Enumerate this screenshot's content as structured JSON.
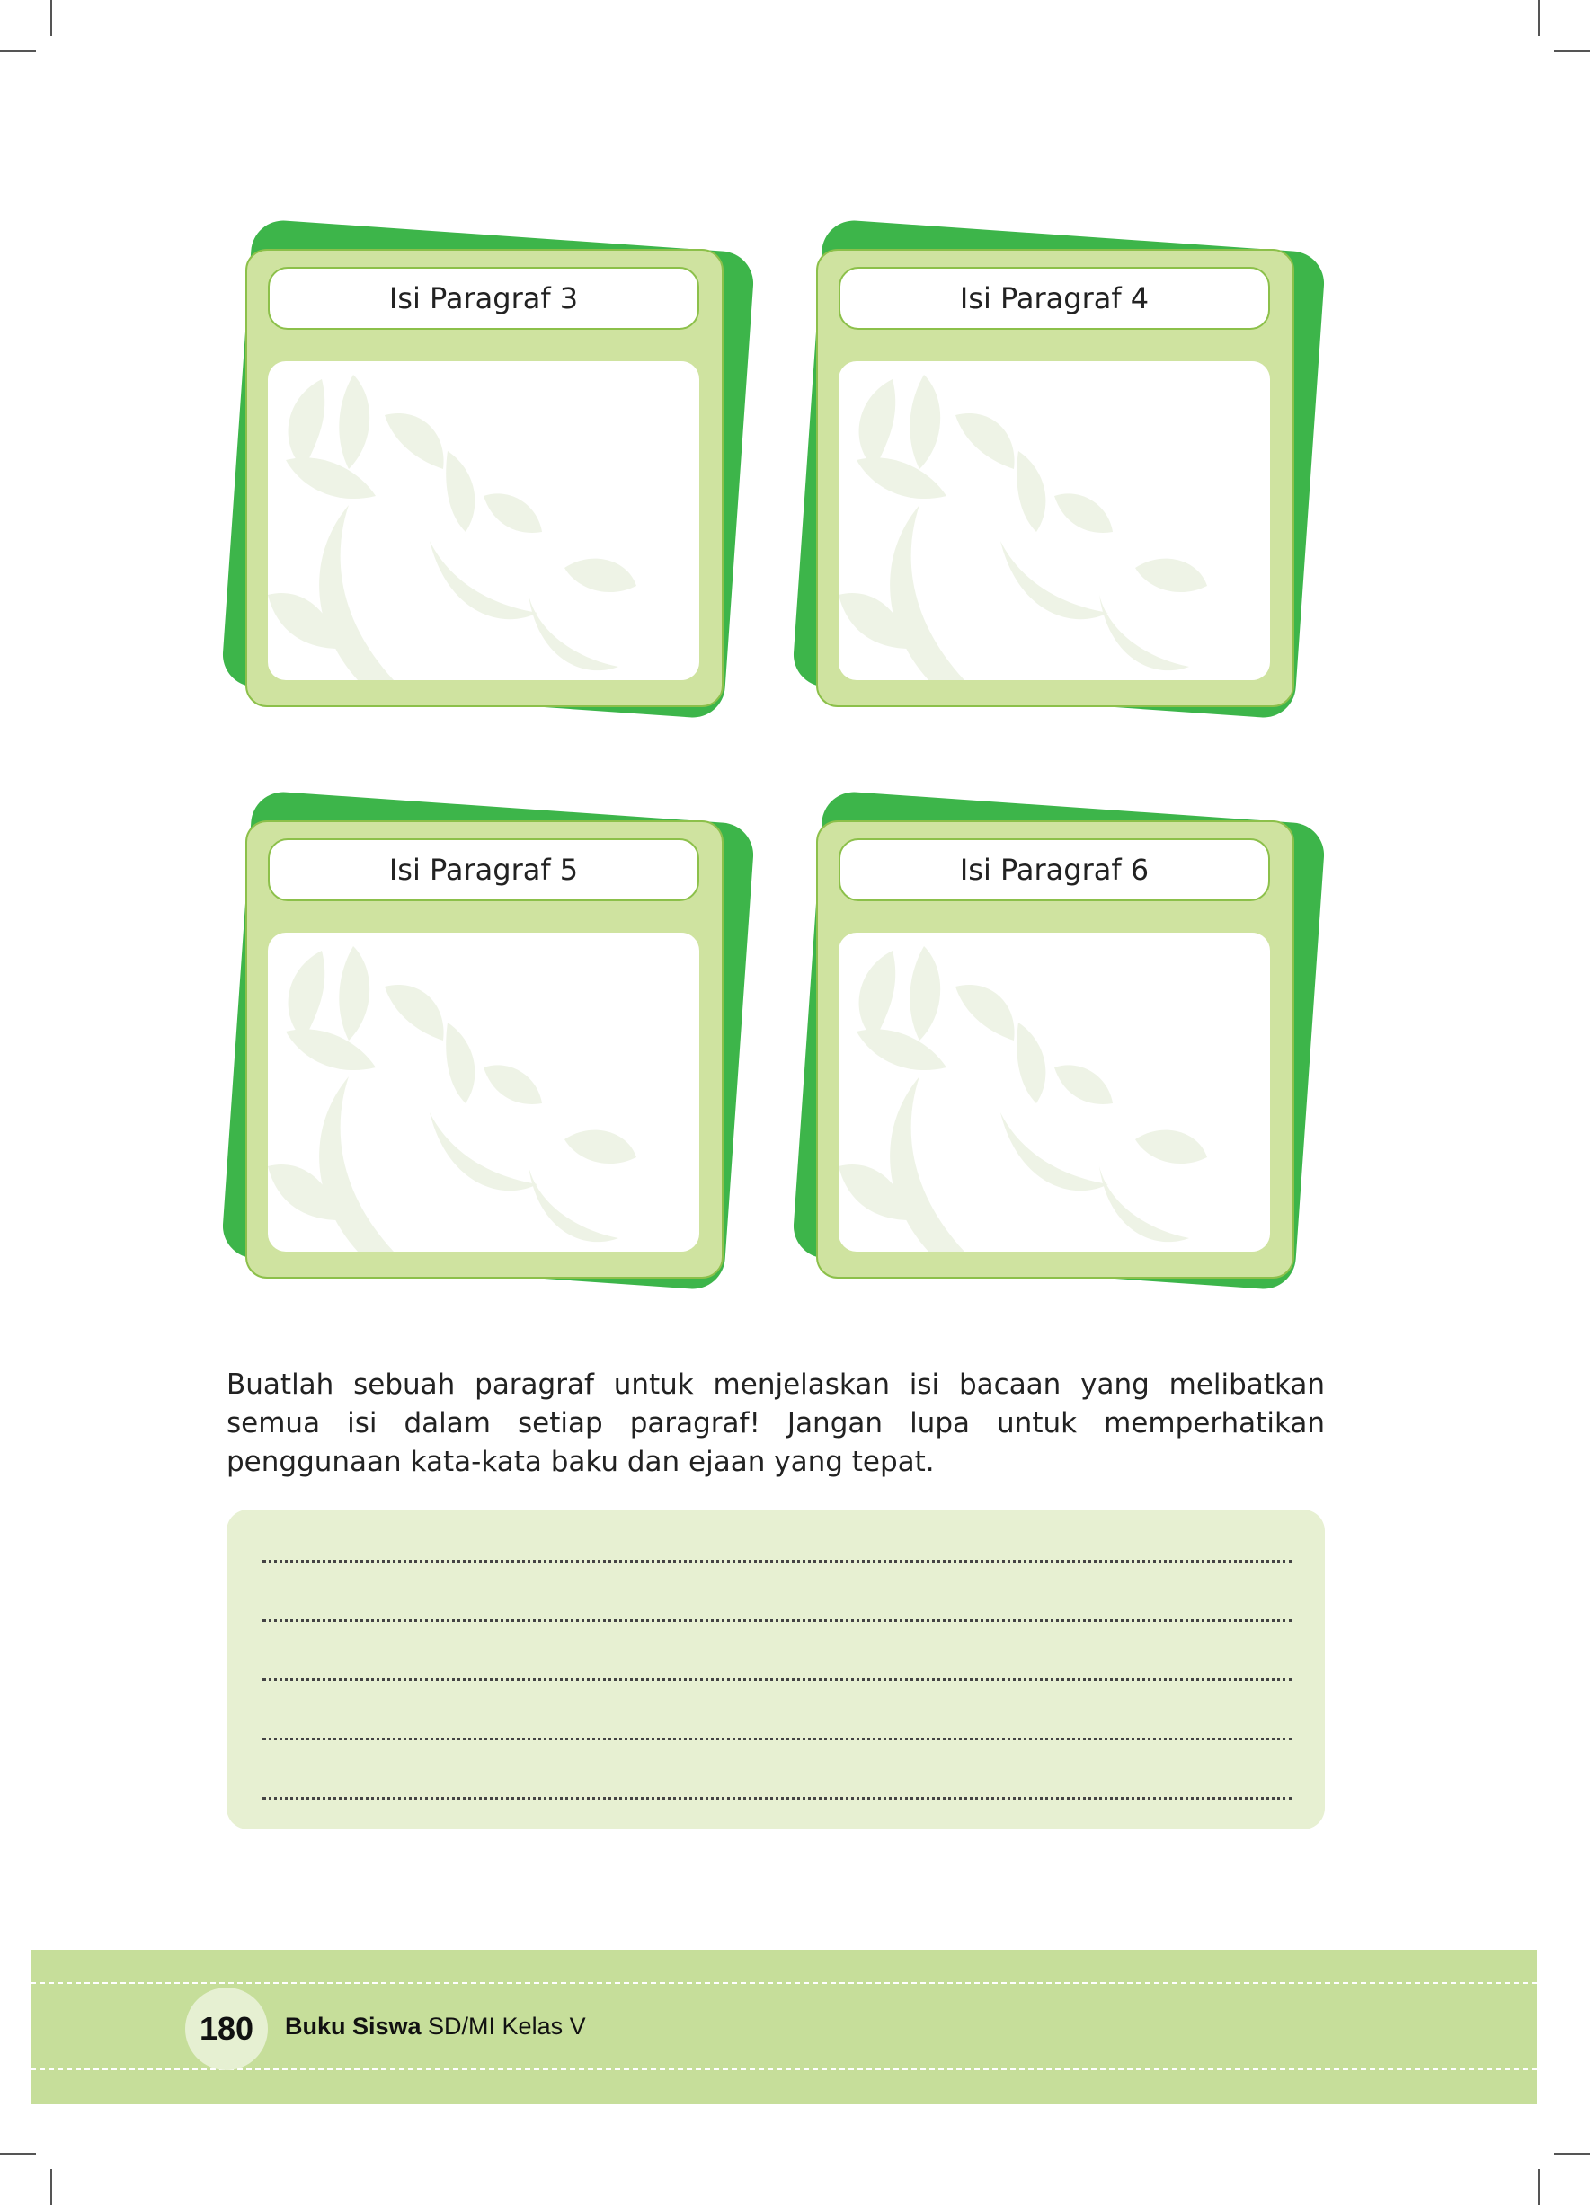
{
  "cards": [
    {
      "title": "Isi Paragraf 3"
    },
    {
      "title": "Isi Paragraf 4"
    },
    {
      "title": "Isi Paragraf 5"
    },
    {
      "title": "Isi Paragraf 6"
    }
  ],
  "instruction": "Buatlah sebuah paragraf untuk menjelaskan isi bacaan yang melibatkan semua isi dalam setiap paragraf! Jangan lupa untuk memperhatikan penggunaan kata-kata baku dan ejaan yang tepat.",
  "answer_lines": 5,
  "footer": {
    "page_number": "180",
    "book_bold": "Buku Siswa",
    "book_rest": " SD/MI Kelas V"
  },
  "colors": {
    "card_back": "#3db54a",
    "card_frame": "#cfe3a0",
    "frame_border": "#8cc04a",
    "answer_box": "#e7f0d2",
    "footer_band": "#c6de9a"
  }
}
